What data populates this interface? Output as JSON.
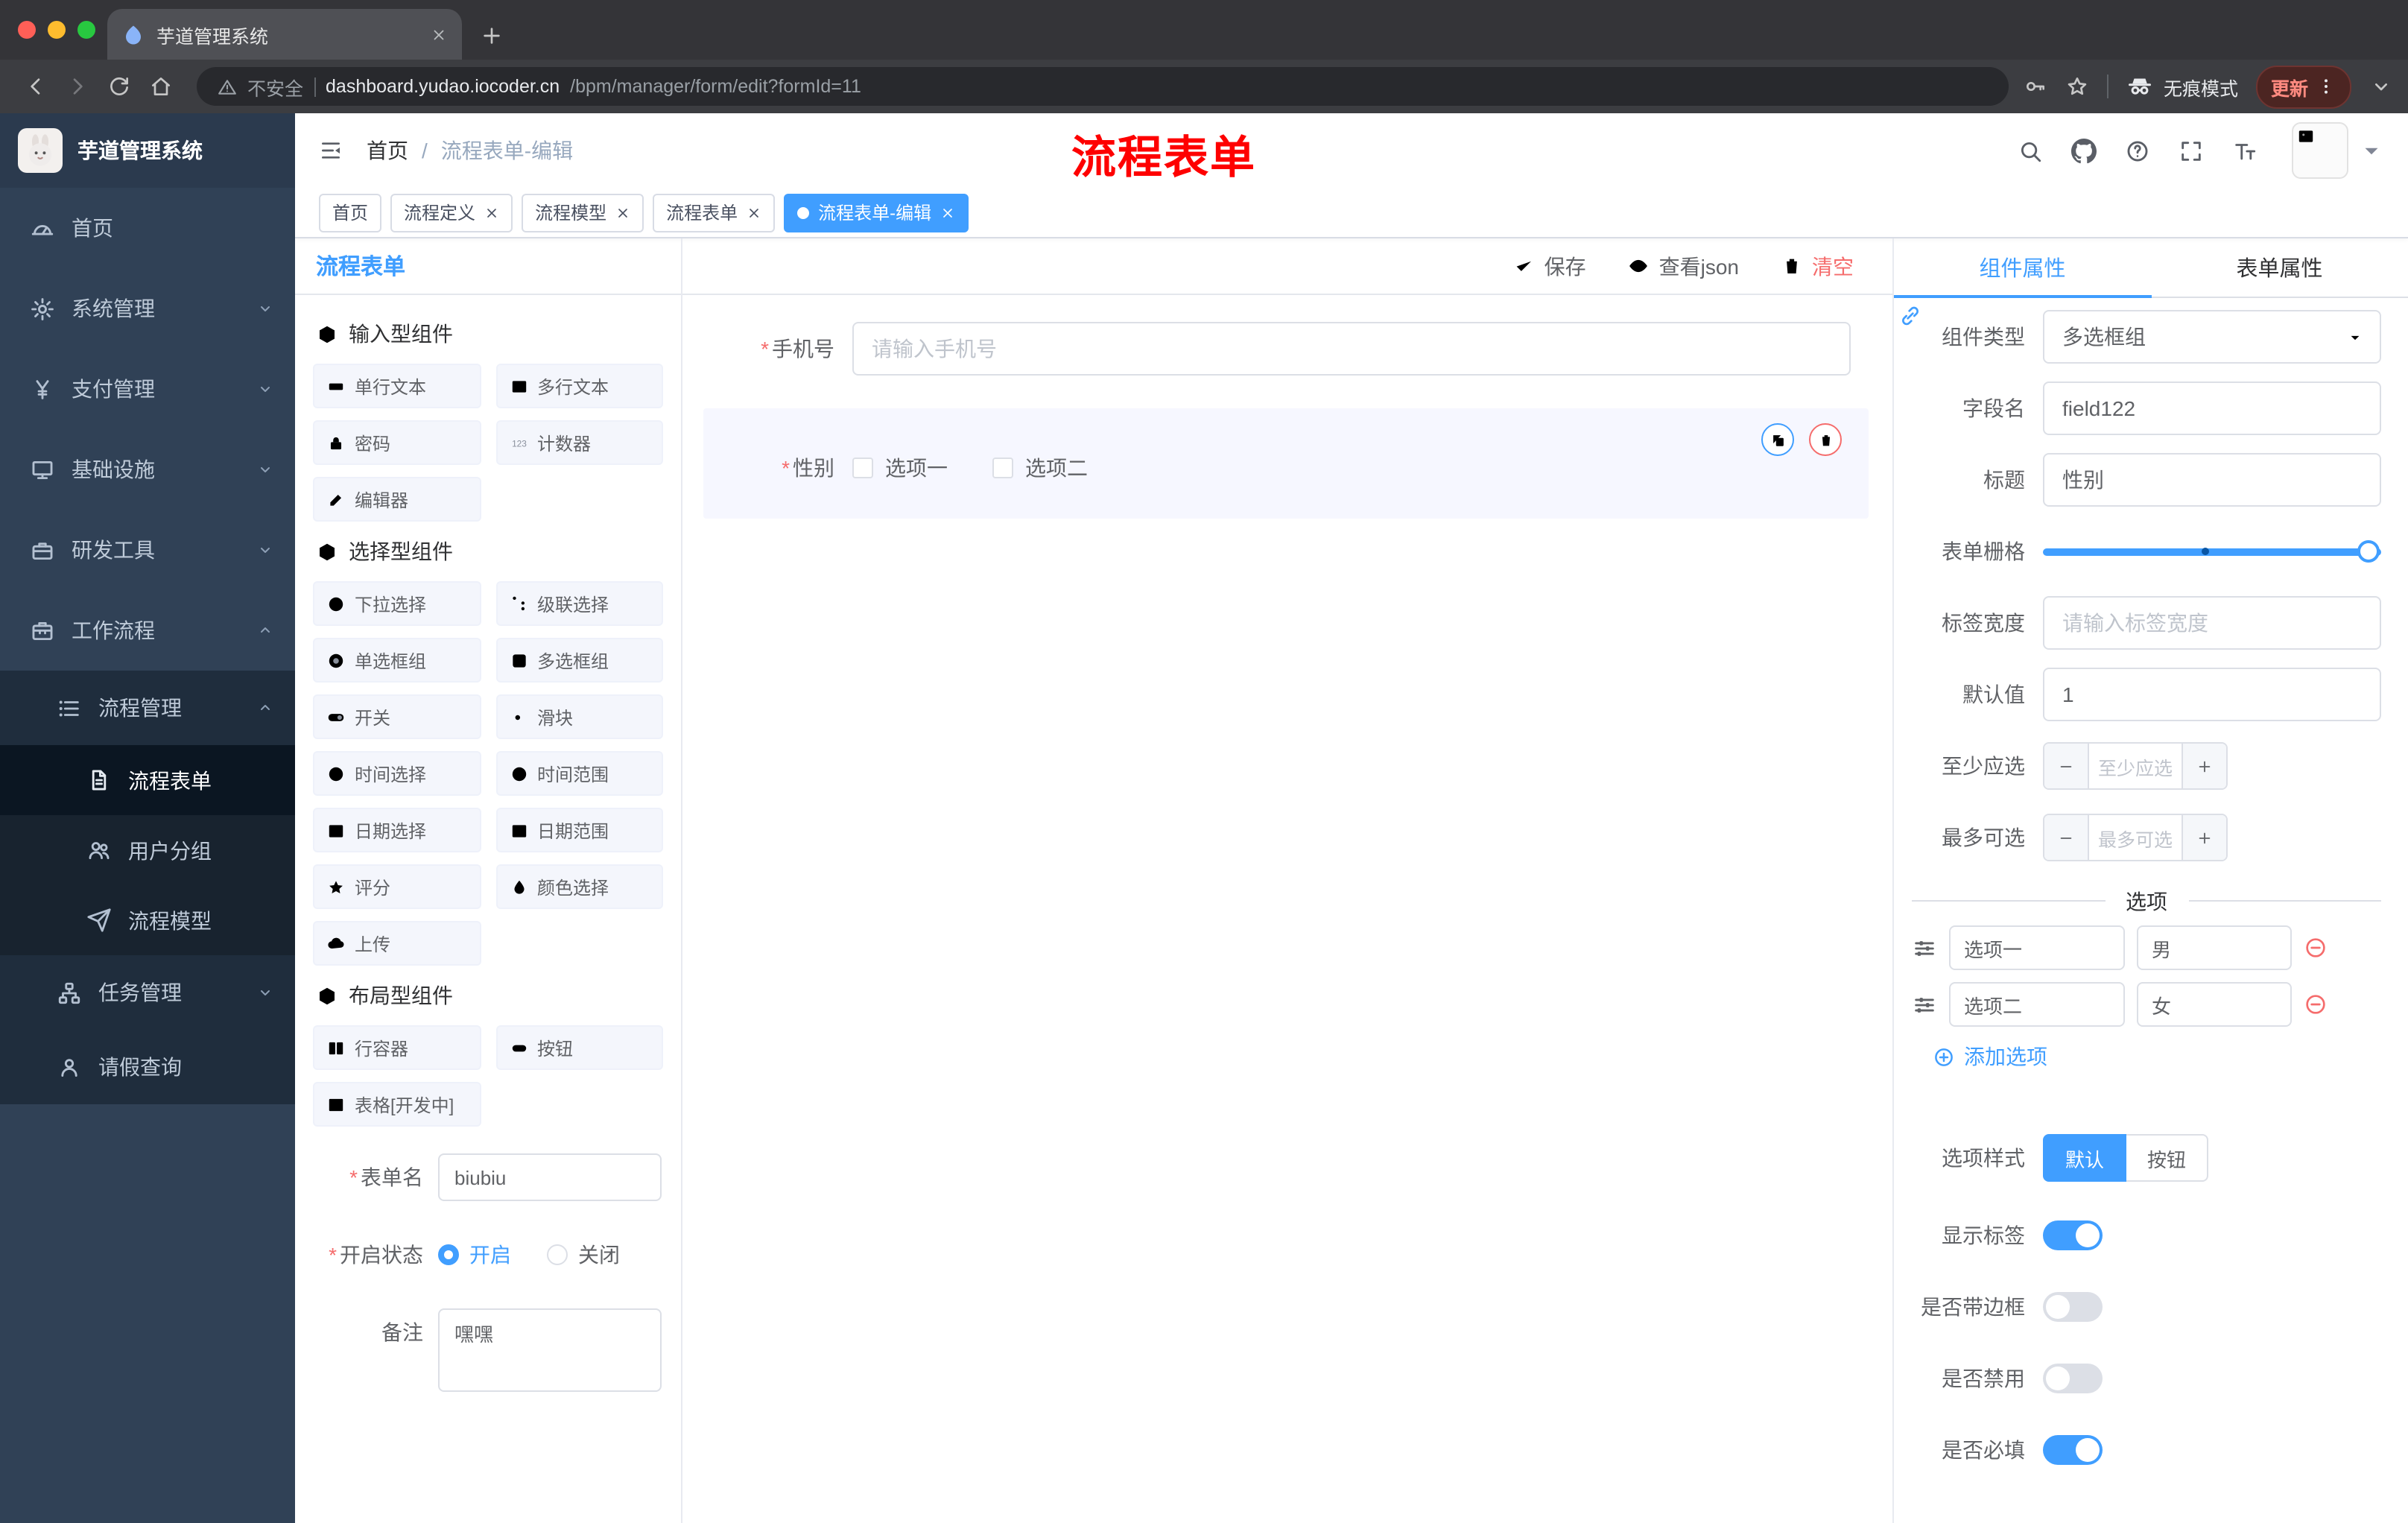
{
  "colors": {
    "primary": "#409eff",
    "danger": "#f56c6c",
    "sidebar_bg": "#304156",
    "submenu_bg": "#1f2d3d",
    "annotation_red": "#fe0000"
  },
  "browser": {
    "tab_title": "芋道管理系统",
    "security_label": "不安全",
    "url_domain": "dashboard.yudao.iocoder.cn",
    "url_path": "/bpm/manager/form/edit?formId=11",
    "incognito_label": "无痕模式",
    "update_label": "更新"
  },
  "app": {
    "logo_title": "芋道管理系统",
    "breadcrumb": {
      "home": "首页",
      "separator": "/",
      "current": "流程表单-编辑"
    },
    "overlay_title": "流程表单",
    "menu": [
      {
        "label": "首页"
      },
      {
        "label": "系统管理"
      },
      {
        "label": "支付管理"
      },
      {
        "label": "基础设施"
      },
      {
        "label": "研发工具"
      },
      {
        "label": "工作流程"
      },
      {
        "label": "流程管理"
      },
      {
        "label": "流程表单"
      },
      {
        "label": "用户分组"
      },
      {
        "label": "流程模型"
      },
      {
        "label": "任务管理"
      },
      {
        "label": "请假查询"
      }
    ],
    "tags": [
      {
        "label": "首页"
      },
      {
        "label": "流程定义"
      },
      {
        "label": "流程模型"
      },
      {
        "label": "流程表单"
      },
      {
        "label": "流程表单-编辑"
      }
    ]
  },
  "palette": {
    "title": "流程表单",
    "sections": [
      {
        "title": "输入型组件",
        "items": [
          "单行文本",
          "多行文本",
          "密码",
          "计数器",
          "编辑器"
        ]
      },
      {
        "title": "选择型组件",
        "items": [
          "下拉选择",
          "级联选择",
          "单选框组",
          "多选框组",
          "开关",
          "滑块",
          "时间选择",
          "时间范围",
          "日期选择",
          "日期范围",
          "评分",
          "颜色选择",
          "上传"
        ]
      },
      {
        "title": "布局型组件",
        "items": [
          "行容器",
          "按钮",
          "表格[开发中]"
        ]
      }
    ],
    "form": {
      "name_label": "表单名",
      "name_value": "biubiu",
      "status_label": "开启状态",
      "status_on": "开启",
      "status_off": "关闭",
      "remark_label": "备注",
      "remark_value": "嘿嘿"
    }
  },
  "toolbar": {
    "save": "保存",
    "view_json": "查看json",
    "clear": "清空"
  },
  "canvas": {
    "phone_label": "手机号",
    "phone_placeholder": "请输入手机号",
    "gender_label": "性别",
    "gender_option1": "选项一",
    "gender_option2": "选项二"
  },
  "props": {
    "tab_component": "组件属性",
    "tab_form": "表单属性",
    "type_label": "组件类型",
    "type_value": "多选框组",
    "field_label": "字段名",
    "field_value": "field122",
    "title_label": "标题",
    "title_value": "性别",
    "grid_label": "表单栅格",
    "width_label": "标签宽度",
    "width_placeholder": "请输入标签宽度",
    "default_label": "默认值",
    "default_value": "1",
    "min_label": "至少应选",
    "min_placeholder": "至少应选",
    "max_label": "最多可选",
    "max_placeholder": "最多可选",
    "options_title": "选项",
    "options": [
      {
        "label": "选项一",
        "value": "男"
      },
      {
        "label": "选项二",
        "value": "女"
      }
    ],
    "add_option": "添加选项",
    "style_label": "选项样式",
    "style_default": "默认",
    "style_button": "按钮",
    "show_label": "显示标签",
    "border_label": "是否带边框",
    "disabled_label": "是否禁用",
    "required_label": "是否必填"
  }
}
